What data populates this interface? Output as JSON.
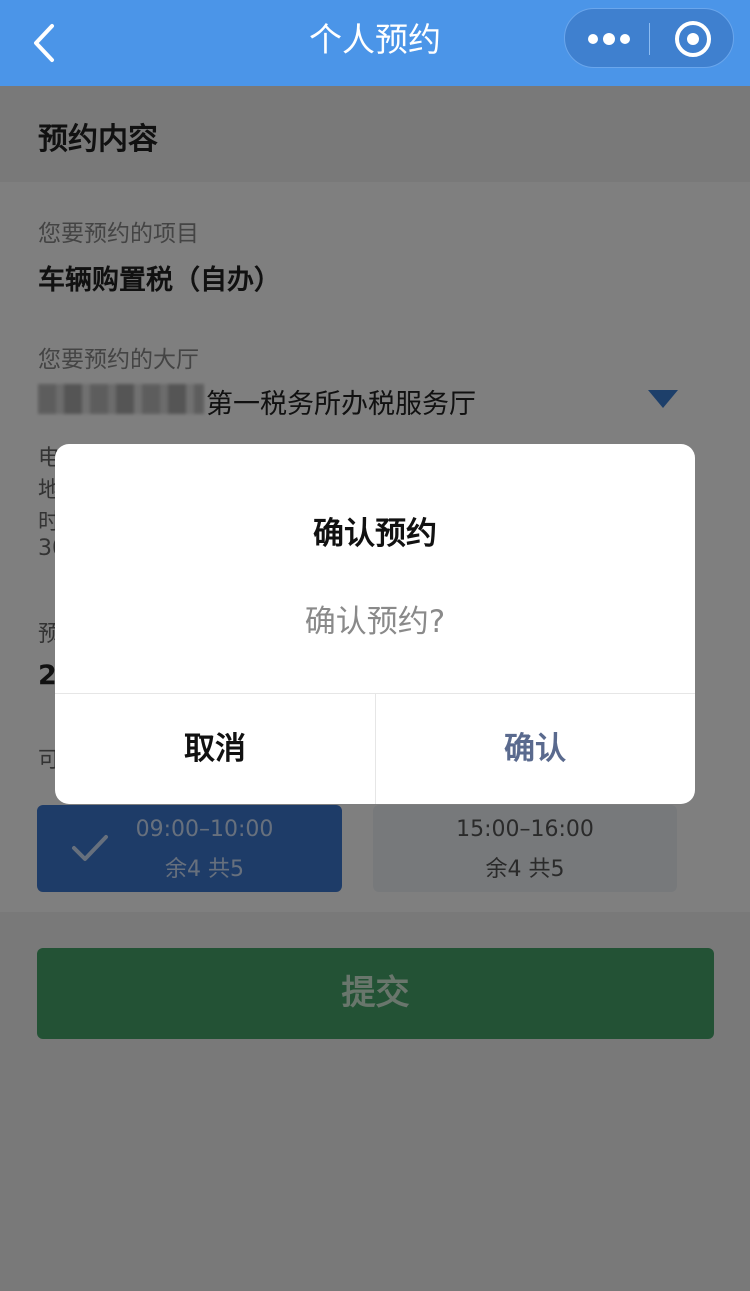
{
  "navbar": {
    "title": "个人预约",
    "back_icon": "chevron-left-icon",
    "more_icon": "more-dots-icon",
    "target_icon": "target-icon",
    "color": "#4b95e8"
  },
  "section": {
    "title": "预约内容"
  },
  "form": {
    "item_label": "您要预约的项目",
    "item_value": "车辆购置税（自办）",
    "hall_label": "您要预约的大厅",
    "hall_value": "第一税务所办税服务厅",
    "info_peek": [
      "电",
      "地",
      "时",
      "30"
    ],
    "date_label_peek": "预",
    "date_value_peek": "2",
    "slot_label_peek": "可"
  },
  "slots": [
    {
      "time": "09:00–10:00",
      "rest": "余4 共5",
      "selected": true
    },
    {
      "time": "15:00–16:00",
      "rest": "余4 共5",
      "selected": false
    }
  ],
  "submit": {
    "label": "提交",
    "color": "#46a46a"
  },
  "dialog": {
    "title": "确认预约",
    "message": "确认预约?",
    "cancel": "取消",
    "confirm": "确认"
  }
}
